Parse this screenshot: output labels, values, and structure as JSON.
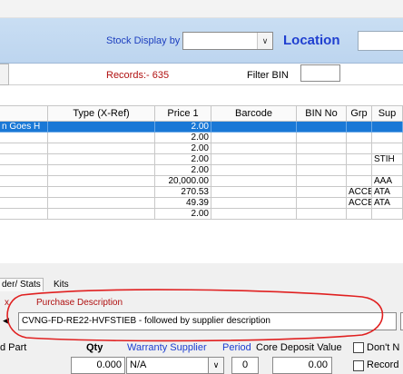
{
  "toolbar": {
    "stock_display_label": "Stock Display by",
    "stock_display_value": "",
    "location_label": "Location",
    "location_value": "",
    "records_text": "Records:- 635",
    "filter_bin_label": "Filter BIN",
    "filter_bin_value": ""
  },
  "grid": {
    "columns": [
      "Type (X-Ref)",
      "Price 1",
      "Barcode",
      "BIN No",
      "Grp",
      "Sup"
    ],
    "rows": [
      {
        "desc": "n Goes H",
        "type": "",
        "price": "2.00",
        "barcode": "",
        "bin": "",
        "grp": "",
        "sup": "",
        "selected": true
      },
      {
        "desc": "",
        "type": "",
        "price": "2.00",
        "barcode": "",
        "bin": "",
        "grp": "",
        "sup": "",
        "selected": false
      },
      {
        "desc": "",
        "type": "",
        "price": "2.00",
        "barcode": "",
        "bin": "",
        "grp": "",
        "sup": "",
        "selected": false
      },
      {
        "desc": "",
        "type": "",
        "price": "2.00",
        "barcode": "",
        "bin": "",
        "grp": "",
        "sup": "STIH",
        "selected": false
      },
      {
        "desc": "",
        "type": "",
        "price": "2.00",
        "barcode": "",
        "bin": "",
        "grp": "",
        "sup": "",
        "selected": false
      },
      {
        "desc": "",
        "type": "",
        "price": "20,000.00",
        "barcode": "",
        "bin": "",
        "grp": "",
        "sup": "AAA",
        "selected": false
      },
      {
        "desc": "",
        "type": "",
        "price": "270.53",
        "barcode": "",
        "bin": "",
        "grp": "ACCES",
        "sup": "ATA",
        "selected": false
      },
      {
        "desc": "",
        "type": "",
        "price": "49.39",
        "barcode": "",
        "bin": "",
        "grp": "ACCES",
        "sup": "ATA",
        "selected": false
      },
      {
        "desc": "",
        "type": "",
        "price": "2.00",
        "barcode": "",
        "bin": "",
        "grp": "",
        "sup": "",
        "selected": false
      }
    ]
  },
  "tabs": {
    "tab1": "der/ Stats",
    "tab2": "Kits"
  },
  "detail": {
    "x_label": "x",
    "purchase_description_label": "Purchase Description",
    "purchase_description_value": "CVNG-FD-RE22-HVFSTIEB - followed by supplier description",
    "left_arrow": "◀"
  },
  "bottom": {
    "part_label": "d Part",
    "qty_label": "Qty",
    "warranty_label": "Warranty Supplier",
    "period_label": "Period",
    "core_deposit_label": "Core Deposit Value",
    "dont_label": "Don't N",
    "record_label": "Record",
    "qty_value": "0.000",
    "warranty_value": "N/A",
    "period_value": "0",
    "core_deposit_value": "0.00"
  },
  "colors": {
    "header_band": "#c9def3",
    "selected_row": "#1a78d6",
    "records_red": "#b01010",
    "link_blue": "#1d3fd0",
    "annotation_red": "#e02020"
  },
  "icons": {
    "dropdown": "chevron-down-icon",
    "arrow": "left-arrow-icon"
  }
}
